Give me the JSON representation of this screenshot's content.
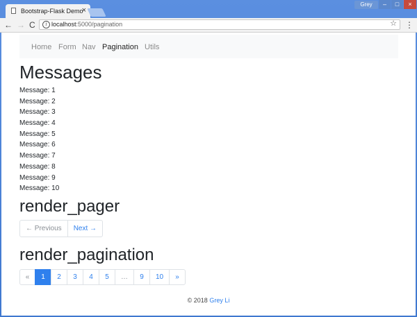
{
  "browser": {
    "tab_title": "Bootstrap-Flask Demo",
    "tab_close": "×",
    "user": "Grey",
    "win_min": "–",
    "win_max": "□",
    "win_close": "×",
    "url_host": "localhost",
    "url_path": ":5000/pagination",
    "back": "←",
    "forward": "→",
    "reload": "C",
    "star": "☆",
    "menu": "⋮",
    "info": "i"
  },
  "nav": {
    "items": [
      {
        "label": "Home",
        "active": false
      },
      {
        "label": "Form",
        "active": false
      },
      {
        "label": "Nav",
        "active": false
      },
      {
        "label": "Pagination",
        "active": true
      },
      {
        "label": "Utils",
        "active": false
      }
    ]
  },
  "main": {
    "messages_heading": "Messages",
    "messages": [
      "Message: 1",
      "Message: 2",
      "Message: 3",
      "Message: 4",
      "Message: 5",
      "Message: 6",
      "Message: 7",
      "Message: 8",
      "Message: 9",
      "Message: 10"
    ],
    "pager_heading": "render_pager",
    "pager": {
      "previous": "← Previous",
      "next": "Next →"
    },
    "pagination_heading": "render_pagination",
    "pagination": [
      "«",
      "1",
      "2",
      "3",
      "4",
      "5",
      "…",
      "9",
      "10",
      "»"
    ]
  },
  "footer": {
    "copyright": "© 2018",
    "author": "Grey Li"
  },
  "colors": {
    "accent": "#2f80ed",
    "navbar_bg": "#f8f9fa"
  }
}
